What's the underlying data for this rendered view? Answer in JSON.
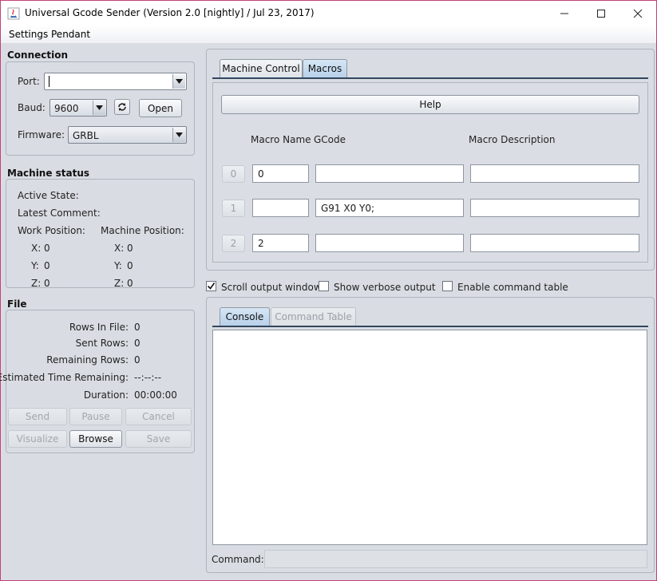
{
  "window": {
    "title": "Universal Gcode Sender (Version 2.0 [nightly]  / Jul 23, 2017)"
  },
  "menu": [
    "Settings",
    "Pendant"
  ],
  "connection": {
    "section_title": "Connection",
    "port_label": "Port:",
    "port_value": "",
    "baud_label": "Baud:",
    "baud_value": "9600",
    "open_button": "Open",
    "firmware_label": "Firmware:",
    "firmware_value": "GRBL"
  },
  "machine_status": {
    "section_title": "Machine status",
    "active_state_label": "Active State:",
    "latest_comment_label": "Latest Comment:",
    "work_position_label": "Work Position:",
    "machine_position_label": "Machine Position:",
    "work": [
      {
        "axis": "X:",
        "value": "0"
      },
      {
        "axis": "Y:",
        "value": "0"
      },
      {
        "axis": "Z:",
        "value": "0"
      }
    ],
    "machine": [
      {
        "axis": "X:",
        "value": "0"
      },
      {
        "axis": "Y:",
        "value": "0"
      },
      {
        "axis": "Z:",
        "value": "0"
      }
    ]
  },
  "file": {
    "section_title": "File",
    "rows": [
      {
        "label": "Rows In File:",
        "value": "0"
      },
      {
        "label": "Sent Rows:",
        "value": "0"
      },
      {
        "label": "Remaining Rows:",
        "value": "0"
      },
      {
        "label": "Estimated Time Remaining:",
        "value": "--:--:--"
      },
      {
        "label": "Duration:",
        "value": "00:00:00"
      }
    ],
    "buttons": {
      "send": "Send",
      "pause": "Pause",
      "cancel": "Cancel",
      "visualize": "Visualize",
      "browse": "Browse",
      "save": "Save"
    }
  },
  "top_tabs": [
    "Machine Control",
    "Macros"
  ],
  "macros": {
    "help_button": "Help",
    "headers": {
      "name": "Macro Name",
      "gcode": "GCode",
      "description": "Macro Description"
    },
    "rows": [
      {
        "index": "0",
        "name": "0",
        "gcode": "",
        "description": ""
      },
      {
        "index": "1",
        "name": "",
        "gcode": "G91 X0 Y0;",
        "description": ""
      },
      {
        "index": "2",
        "name": "2",
        "gcode": "",
        "description": ""
      }
    ]
  },
  "options": {
    "scroll_output": {
      "label": "Scroll output window",
      "checked": true
    },
    "verbose_output": {
      "label": "Show verbose output",
      "checked": false
    },
    "command_table": {
      "label": "Enable command table",
      "checked": false
    }
  },
  "bottom_tabs": [
    "Console",
    "Command Table"
  ],
  "console": {
    "command_label": "Command:",
    "command_value": ""
  }
}
